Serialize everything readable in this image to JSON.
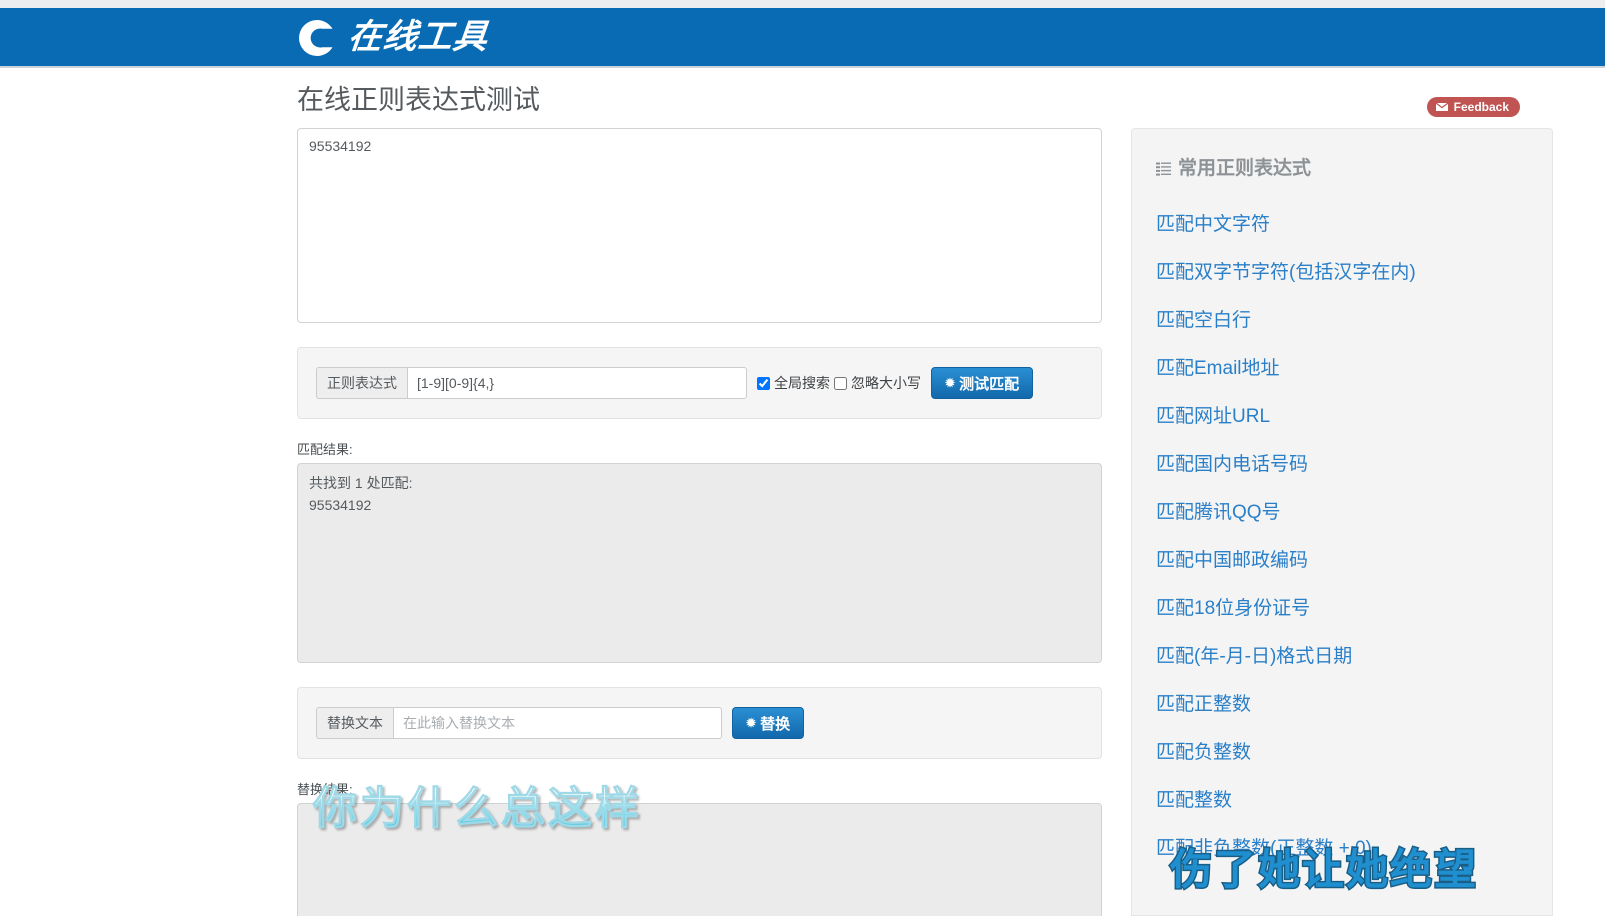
{
  "header": {
    "brand_logo": "c-logo-icon",
    "brand_text": "在线工具",
    "background_color": "#0a6bb5"
  },
  "page_title": "在线正则表达式测试",
  "feedback": {
    "label": "Feedback",
    "icon": "envelope-icon",
    "color": "#bf5453"
  },
  "source": {
    "value": "95534192"
  },
  "regex_panel": {
    "addon_label": "正则表达式",
    "value": "[1-9][0-9]{4,}",
    "placeholder": "",
    "global_search_label": "全局搜索",
    "global_search_checked": true,
    "ignore_case_label": "忽略大小写",
    "ignore_case_checked": false,
    "test_button_label": "测试匹配",
    "test_button_icon": "chevron-down-icon",
    "button_color": "#1268ab"
  },
  "match_result": {
    "label": "匹配结果:",
    "value": "共找到 1 处匹配:\n95534192"
  },
  "replace_panel": {
    "addon_label": "替换文本",
    "value": "",
    "placeholder": "在此输入替换文本",
    "button_label": "替换",
    "button_icon": "chevron-down-icon"
  },
  "replace_result": {
    "label": "替换结果:",
    "value": ""
  },
  "sidebar": {
    "title": "常用正则表达式",
    "title_icon": "list-icon",
    "link_color": "#2a7fc9",
    "items": [
      {
        "label": "匹配中文字符"
      },
      {
        "label": "匹配双字节字符(包括汉字在内)"
      },
      {
        "label": "匹配空白行"
      },
      {
        "label": "匹配Email地址"
      },
      {
        "label": "匹配网址URL"
      },
      {
        "label": "匹配国内电话号码"
      },
      {
        "label": "匹配腾讯QQ号"
      },
      {
        "label": "匹配中国邮政编码"
      },
      {
        "label": "匹配18位身份证号"
      },
      {
        "label": "匹配(年-月-日)格式日期"
      },
      {
        "label": "匹配正整数"
      },
      {
        "label": "匹配负整数"
      },
      {
        "label": "匹配整数"
      },
      {
        "label": "匹配非负整数(正整数 + 0)"
      }
    ]
  },
  "watermarks": [
    {
      "text": "你为什么总这样"
    },
    {
      "text": "伤了她让她绝望"
    }
  ]
}
